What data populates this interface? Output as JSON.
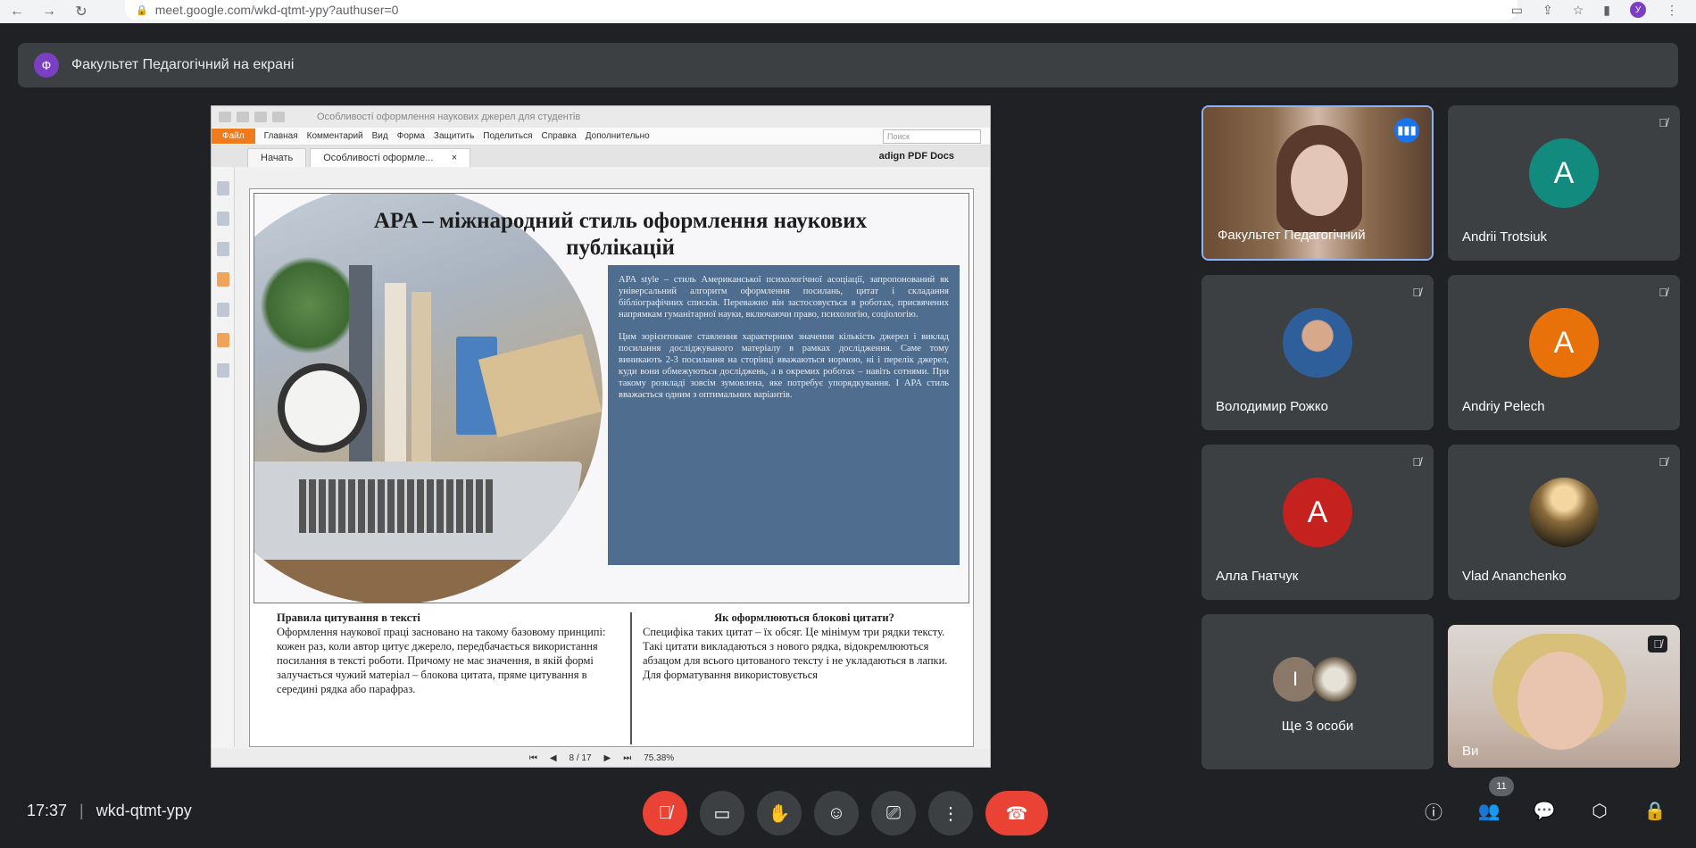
{
  "browser": {
    "url": "meet.google.com/wkd-qtmt-ypy?authuser=0",
    "profile_letter": "У"
  },
  "banner": {
    "avatar_letter": "Ф",
    "text": "Факультет Педагогічний на екрані"
  },
  "pdf": {
    "title_text": "Особливості оформлення наукових джерел для студентів",
    "file_label": "Файл",
    "menu": [
      "Главная",
      "Комментарий",
      "Вид",
      "Форма",
      "Защитить",
      "Поделиться",
      "Справка",
      "Дополнительно"
    ],
    "search_placeholder": "Поиск",
    "tabs": [
      "Начать",
      "Особливості оформле..."
    ],
    "brand": "adign PDF Docs",
    "slide_title": "APA – міжнародний стиль оформлення наукових публікацій",
    "box_p1": "APA style – стиль Американської психологічної асоціації, запропонований як універсальний алгоритм оформлення посилань, цитат і складання бібліографічних списків. Переважно він застосовується в роботах, присвячених напрямкам гуманітарної науки, включаючи право, психологію, соціологію.",
    "box_p2": "Цим зорієнтоване ставлення характерним значення кількість джерел і виклад посилання досліджуваного матеріалу в рамках дослідження. Саме тому виникають 2-3 посилання на сторінці вважаються нормою, ні і перелік джерел, куди вони обмежуються досліджень, а в окремих роботах – навіть сотнями. При такому розкладі зовсім зумовлена, яке потребує упорядкування. І APA стиль вважається одним з оптимальних варіантів.",
    "left_heading": "Правила цитування в тексті",
    "left_text": "Оформлення наукової праці засновано на такому базовому принципі: кожен раз, коли автор цитує джерело, передбачається використання посилання в тексті роботи. Причому не має значення, в якій формі залучається чужий матеріал – блокова цитата, пряме цитування в середині рядка або парафраз.",
    "right_heading": "Як оформлюються блокові цитати?",
    "right_text": "Специфіка таких цитат – їх обсяг. Це мінімум три рядки тексту. Такі цитати викладаються з нового рядка, відокремлюються абзацом для всього цитованого тексту і не укладаються в лапки. Для форматування використовується",
    "page_indicator": "8 / 17",
    "zoom": "75.38%"
  },
  "participants": [
    {
      "name": "Факультет Педагогічний",
      "type": "video",
      "speaking": true
    },
    {
      "name": "Andrii Trotsiuk",
      "type": "letter",
      "letter": "A",
      "color": "#128a7e"
    },
    {
      "name": "Володимир Рожко",
      "type": "photo"
    },
    {
      "name": "Andriy Pelech",
      "type": "letter",
      "letter": "A",
      "color": "#e8710a"
    },
    {
      "name": "Алла Гнатчук",
      "type": "letter",
      "letter": "A",
      "color": "#c5221f"
    },
    {
      "name": "Vlad Ananchenko",
      "type": "photo"
    },
    {
      "name": "Ще 3 особи",
      "type": "group",
      "letter": "І"
    },
    {
      "name": "Ви",
      "type": "video"
    }
  ],
  "meeting": {
    "time": "17:37",
    "code": "wkd-qtmt-ypy",
    "participant_count": "11"
  },
  "icons": {
    "mic_off": "mic-off-icon",
    "camera": "camera-icon",
    "raise_hand": "hand-icon",
    "emoji": "emoji-icon",
    "present": "present-icon",
    "more": "more-icon",
    "end_call": "end-call-icon",
    "info": "info-icon",
    "people": "people-icon",
    "chat": "chat-icon",
    "activities": "activities-icon",
    "host_controls": "lock-icon"
  },
  "colors": {
    "end_call": "#ea4335",
    "speaking": "#1a73e8",
    "presenter_accent": "#7b3fc4"
  }
}
